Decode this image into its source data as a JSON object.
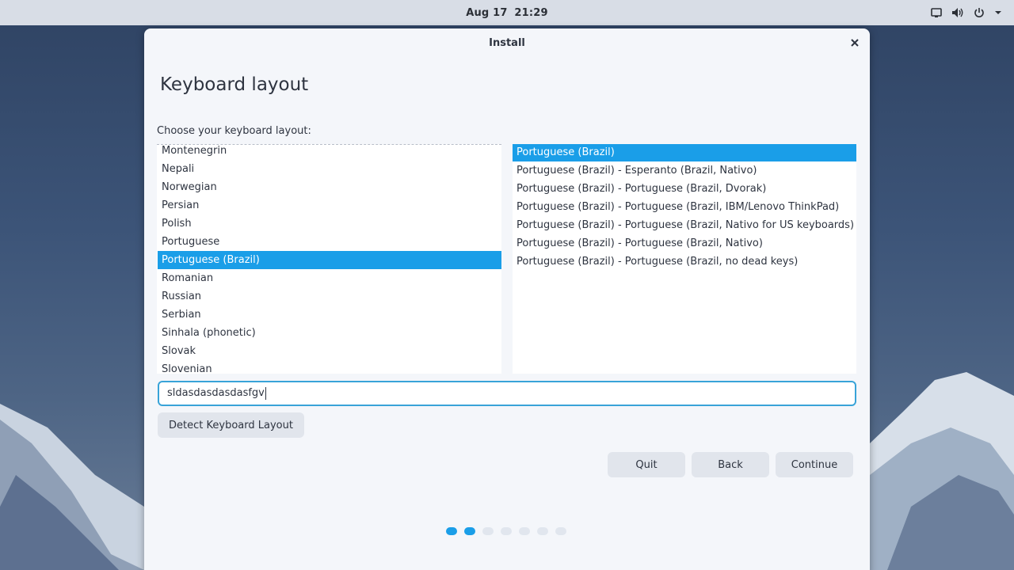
{
  "topbar": {
    "date": "Aug 17",
    "time": "21:29",
    "icons": [
      "screen-icon",
      "volume-icon",
      "power-icon",
      "caret-down-icon"
    ]
  },
  "window": {
    "title": "Install",
    "heading": "Keyboard layout",
    "prompt": "Choose your keyboard layout:"
  },
  "layouts": [
    "Montenegrin",
    "Nepali",
    "Norwegian",
    "Persian",
    "Polish",
    "Portuguese",
    "Portuguese (Brazil)",
    "Romanian",
    "Russian",
    "Serbian",
    "Sinhala (phonetic)",
    "Slovak",
    "Slovenian"
  ],
  "selected_layout_index": 6,
  "variants": [
    "Portuguese (Brazil)",
    "Portuguese (Brazil) - Esperanto (Brazil, Nativo)",
    "Portuguese (Brazil) - Portuguese (Brazil, Dvorak)",
    "Portuguese (Brazil) - Portuguese (Brazil, IBM/Lenovo ThinkPad)",
    "Portuguese (Brazil) - Portuguese (Brazil, Nativo for US keyboards)",
    "Portuguese (Brazil) - Portuguese (Brazil, Nativo)",
    "Portuguese (Brazil) - Portuguese (Brazil, no dead keys)"
  ],
  "selected_variant_index": 0,
  "test_input": {
    "value": "sldasdasdasdasfgv"
  },
  "buttons": {
    "detect": "Detect Keyboard Layout",
    "quit": "Quit",
    "back": "Back",
    "continue": "Continue"
  },
  "progress": {
    "total_steps": 7,
    "completed_steps": 2
  },
  "colors": {
    "accent": "#1a9ee8",
    "panel": "#d8dde6",
    "window": "#f4f6fa"
  }
}
